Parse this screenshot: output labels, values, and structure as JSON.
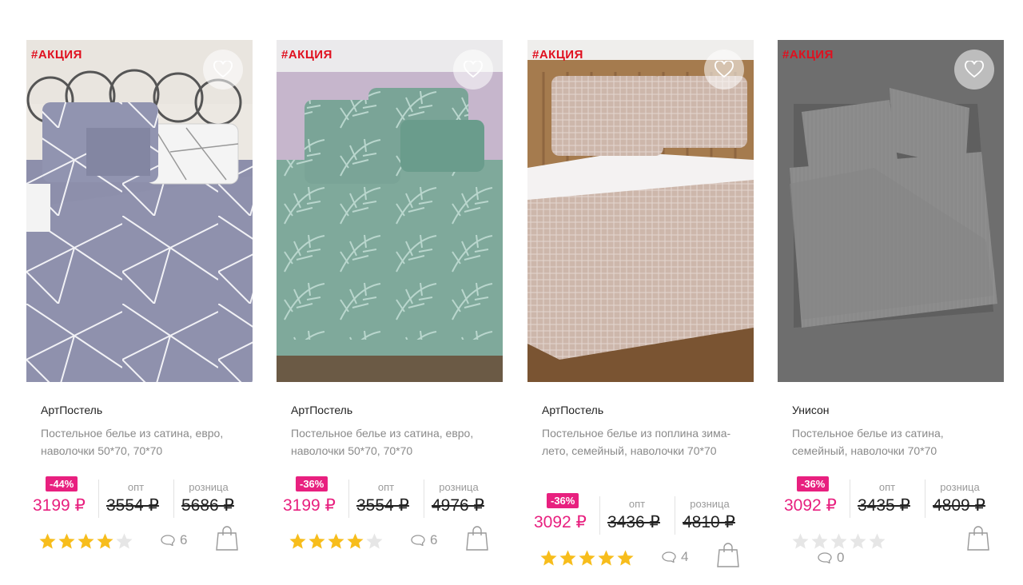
{
  "products": [
    {
      "promo": "#АКЦИЯ",
      "brand": "АртПостель",
      "title": "Постельное белье из сатина, евро, наволочки 50*70, 70*70",
      "discount": "-44%",
      "price": "3199 ₽",
      "opt_label": "опт",
      "opt_price": "3554 ₽",
      "retail_label": "розница",
      "retail_price": "5686 ₽",
      "rating": 4,
      "comments": "6"
    },
    {
      "promo": "#АКЦИЯ",
      "brand": "АртПостель",
      "title": "Постельное белье из сатина, евро, наволочки 50*70, 70*70",
      "discount": "-36%",
      "price": "3199 ₽",
      "opt_label": "опт",
      "opt_price": "3554 ₽",
      "retail_label": "розница",
      "retail_price": "4976 ₽",
      "rating": 4,
      "comments": "6"
    },
    {
      "promo": "#АКЦИЯ",
      "brand": "АртПостель",
      "title": "Постельное белье из поплина зима-лето, семейный, наволочки 70*70",
      "discount": "-36%",
      "price": "3092 ₽",
      "opt_label": "опт",
      "opt_price": "3436 ₽",
      "retail_label": "розница",
      "retail_price": "4810 ₽",
      "rating": 5,
      "comments": "4"
    },
    {
      "promo": "#АКЦИЯ",
      "brand": "Унисон",
      "title": "Постельное белье из сатина, семейный, наволочки 70*70",
      "discount": "-36%",
      "price": "3092 ₽",
      "opt_label": "опт",
      "opt_price": "3435 ₽",
      "retail_label": "розница",
      "retail_price": "4809 ₽",
      "rating": 0,
      "comments": "0"
    }
  ],
  "colors": {
    "accent": "#e8207f",
    "promo": "#e0101f",
    "star": "#f7bd1c",
    "star_empty": "#e6e6e6"
  },
  "icons": {
    "favorite": "heart-icon",
    "comments": "speech-bubble-icon",
    "cart": "shopping-bag-icon",
    "rating": "star-icon"
  }
}
